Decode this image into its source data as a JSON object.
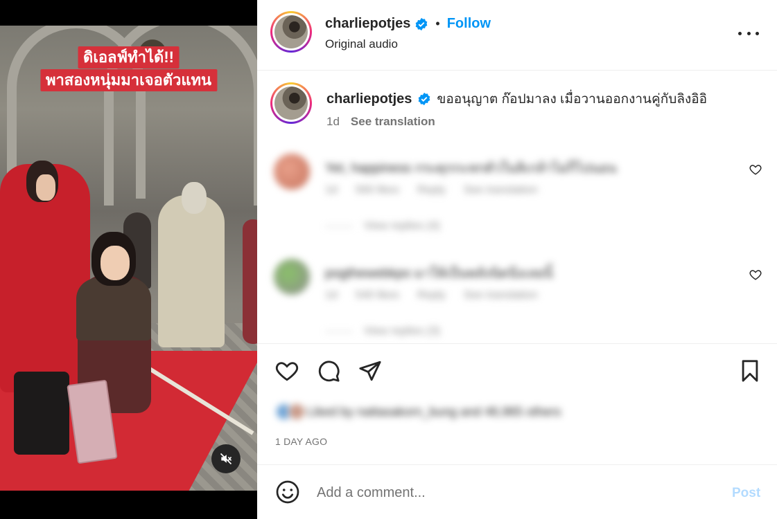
{
  "video": {
    "caption_line1": "ดิเอลฟ์ทำได้!!",
    "caption_line2": "พาสองหนุ่มมาเจอตัวแทน"
  },
  "header": {
    "username": "charliepotjes",
    "separator": "•",
    "follow_label": "Follow",
    "audio": "Original audio"
  },
  "caption": {
    "username": "charliepotjes",
    "text": "ขออนุญาต ก๊อปมาลง เมื่อวานออกงานคู่กับลิงอิอิ",
    "time": "1d",
    "see_translation": "See translation"
  },
  "comments": [
    {
      "text": "Yet, happiness กระดุกกะหกตัวในลิเกล้าไม่ก็ไปนอน",
      "time": "1d",
      "likes": "560 likes",
      "reply": "Reply",
      "see_translation": "See translation",
      "view_replies": "View replies (4)"
    },
    {
      "text": "pogthewebkpo มาให้เป็นพลังนิดนึงเลยนิ้",
      "time": "1d",
      "likes": "540 likes",
      "reply": "Reply",
      "see_translation": "See translation",
      "view_replies": "View replies (3)"
    }
  ],
  "likes_text": "Liked by nattasakorn_bung and 46,965 others",
  "date": "1 DAY AGO",
  "add_comment": {
    "placeholder": "Add a comment...",
    "post_label": "Post"
  },
  "colors": {
    "follow": "#0095f6",
    "verified": "#0095f6",
    "post_disabled": "#b3dbff",
    "caption_box": "#d6303a"
  },
  "icons": [
    "mute-icon",
    "verified-icon",
    "more-icon",
    "heart-icon",
    "comment-icon",
    "share-icon",
    "bookmark-icon",
    "emoji-icon"
  ]
}
